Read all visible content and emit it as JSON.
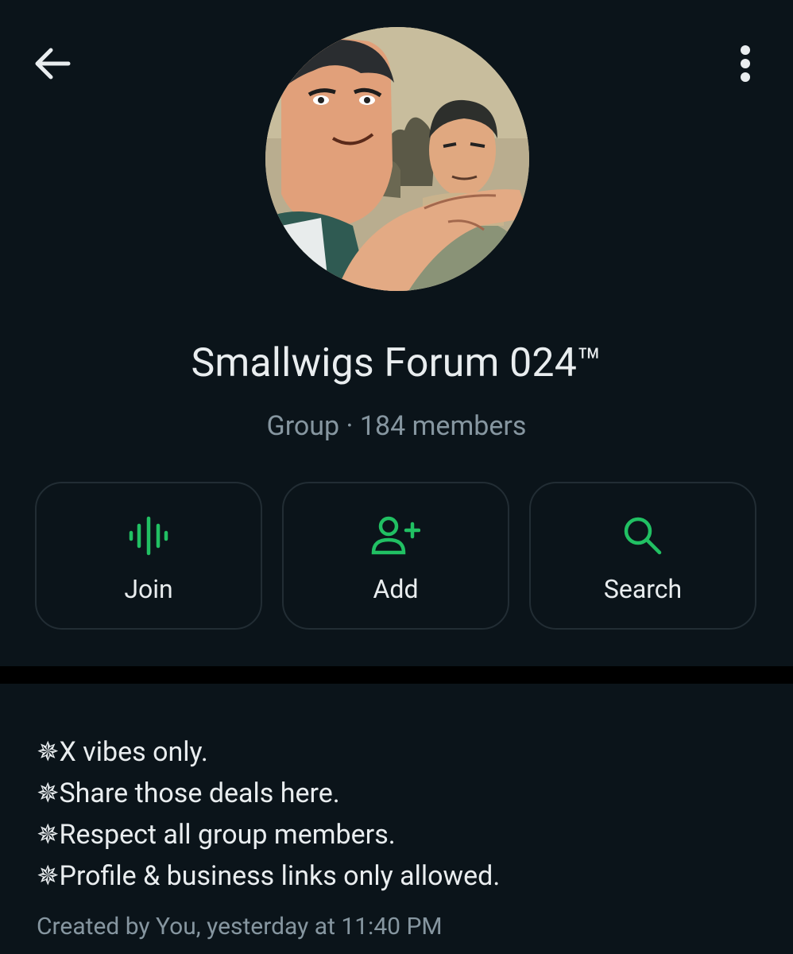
{
  "header": {
    "back_icon": "arrow-left-icon",
    "menu_icon": "more-vertical-icon"
  },
  "group": {
    "name": "Smallwigs Forum 024™",
    "subtitle": "Group · 184 members",
    "avatar_description": "anime-style profile picture"
  },
  "actions": [
    {
      "label": "Join",
      "icon": "audio-waveform-icon"
    },
    {
      "label": "Add",
      "icon": "add-person-icon"
    },
    {
      "label": "Search",
      "icon": "search-icon"
    }
  ],
  "description": {
    "lines": [
      "✵X vibes only.",
      "✵Share those deals here.",
      "✵Respect all group members.",
      "✵Profile & business links only allowed."
    ],
    "created": "Created by You, yesterday at 11:40 PM"
  },
  "colors": {
    "background": "#0b141a",
    "accent": "#21c063",
    "primary_text": "#e9edef",
    "secondary_text": "#8696a0",
    "border": "#222d34"
  }
}
